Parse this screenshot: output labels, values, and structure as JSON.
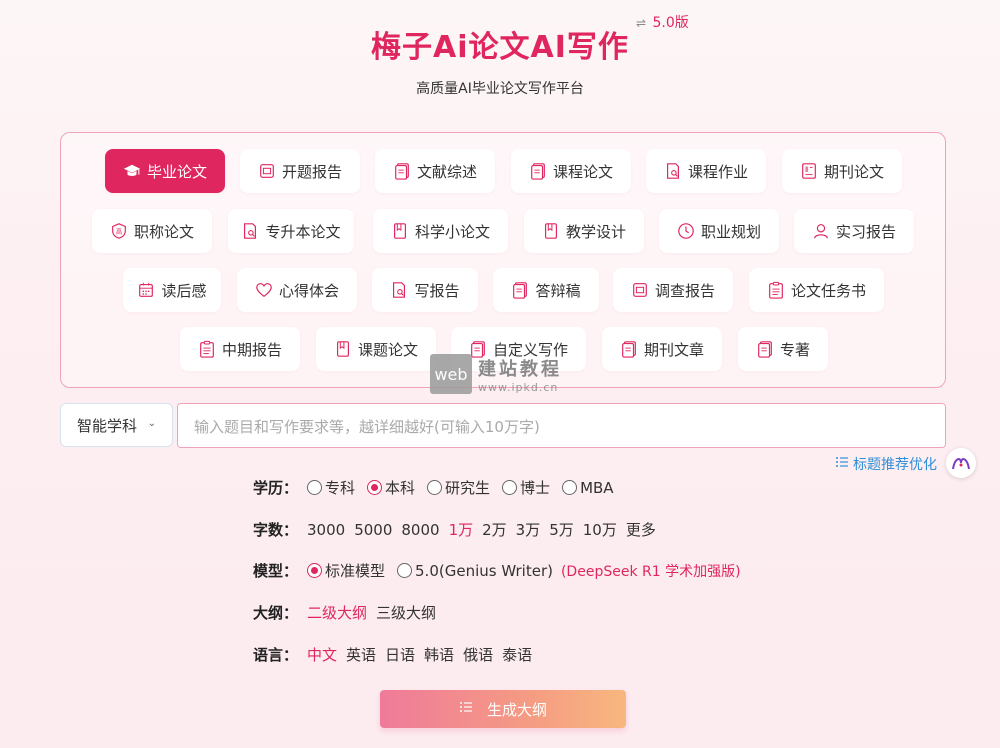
{
  "header": {
    "title": "梅子Ai论文AI写作",
    "version_label": "5.0版",
    "subtitle": "高质量AI毕业论文写作平台"
  },
  "types_row1": [
    {
      "label": "毕业论文",
      "icon": "graduation-cap-icon",
      "active": true
    },
    {
      "label": "开题报告",
      "icon": "report-icon"
    },
    {
      "label": "文献综述",
      "icon": "document-icon"
    },
    {
      "label": "课程论文",
      "icon": "document-icon"
    },
    {
      "label": "课程作业",
      "icon": "document-search-icon"
    },
    {
      "label": "期刊论文",
      "icon": "journal-icon"
    }
  ],
  "types_row2": [
    {
      "label": "职称论文",
      "icon": "shield-icon"
    },
    {
      "label": "专升本论文",
      "icon": "document-search-icon"
    },
    {
      "label": "科学小论文",
      "icon": "book-icon"
    },
    {
      "label": "教学设计",
      "icon": "book-icon"
    },
    {
      "label": "职业规划",
      "icon": "clock-icon"
    },
    {
      "label": "实习报告",
      "icon": "user-icon"
    }
  ],
  "types_row3": [
    {
      "label": "读后感",
      "icon": "calendar-icon"
    },
    {
      "label": "心得体会",
      "icon": "heart-icon"
    },
    {
      "label": "写报告",
      "icon": "document-search-icon"
    },
    {
      "label": "答辩稿",
      "icon": "document-icon"
    },
    {
      "label": "调查报告",
      "icon": "report-icon"
    },
    {
      "label": "论文任务书",
      "icon": "clipboard-icon"
    }
  ],
  "types_row4": [
    {
      "label": "中期报告",
      "icon": "clipboard-icon"
    },
    {
      "label": "课题论文",
      "icon": "book-icon"
    },
    {
      "label": "自定义写作",
      "icon": "document-icon"
    },
    {
      "label": "期刊文章",
      "icon": "document-icon"
    },
    {
      "label": "专著",
      "icon": "document-icon"
    }
  ],
  "watermark": {
    "box": "web",
    "cn": "建站教程",
    "url": "www.ipkd.cn"
  },
  "subject": {
    "value": "智能学科"
  },
  "topic": {
    "placeholder": "输入题目和写作要求等，越详细越好(可输入10万字)"
  },
  "recommend_label": "标题推荐优化",
  "education": {
    "label": "学历：",
    "options": [
      "专科",
      "本科",
      "研究生",
      "博士",
      "MBA"
    ],
    "selected": "本科"
  },
  "wordcount": {
    "label": "字数：",
    "options": [
      "3000",
      "5000",
      "8000",
      "1万",
      "2万",
      "3万",
      "5万",
      "10万",
      "更多"
    ],
    "selected": "1万"
  },
  "model": {
    "label": "模型：",
    "options": [
      "标准模型",
      "5.0(Genius Writer)"
    ],
    "selected": "标准模型",
    "note": "(DeepSeek R1 学术加强版)"
  },
  "outline": {
    "label": "大纲：",
    "options": [
      "二级大纲",
      "三级大纲"
    ],
    "selected": "二级大纲"
  },
  "language": {
    "label": "语言：",
    "options": [
      "中文",
      "英语",
      "日语",
      "韩语",
      "俄语",
      "泰语"
    ],
    "selected": "中文"
  },
  "generate_label": "生成大纲",
  "colors": {
    "accent": "#e0265e",
    "link": "#2f8fd8"
  }
}
